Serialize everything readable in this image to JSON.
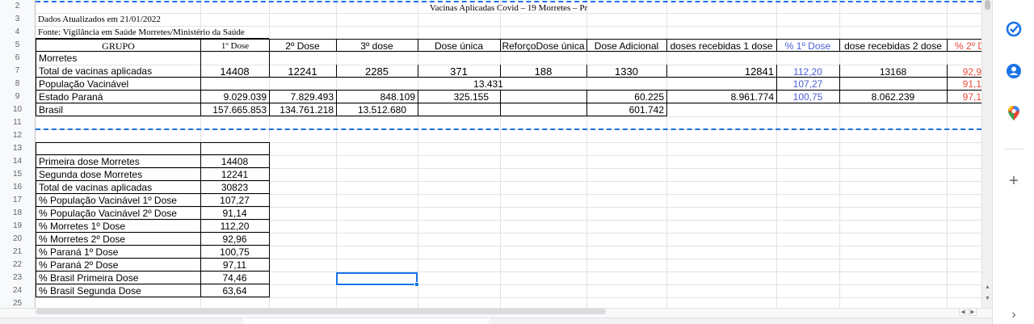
{
  "app": {
    "name": "Google Sheets"
  },
  "row_numbers": [
    "2",
    "3",
    "4",
    "5",
    "6",
    "7",
    "8",
    "9",
    "10",
    "11",
    "12",
    "13",
    "14",
    "15",
    "16",
    "17",
    "18",
    "19",
    "20",
    "21",
    "22",
    "23",
    "24",
    "25"
  ],
  "sheet": {
    "title": "Vacinas Aplicadas Covid – 19 Morretes – Pr",
    "updated": "Dados Atualizados em 21/01/2022",
    "source": "Fonte: Vigilância em Saúde Morretes/Ministério da Saúde",
    "headers": [
      "GRUPO",
      "1º Dose",
      "2º Dose",
      "3º dose",
      "Dose única",
      "ReforçoDose única",
      "Dose Adicional",
      "doses recebidas 1 dose",
      "% 1º Dose",
      "dose recebidas 2 dose",
      "% 2º D"
    ],
    "label_morretes": "Morretes",
    "total": {
      "label": "Total de vacinas aplicadas",
      "d1": "14408",
      "d2": "12241",
      "d3": "2285",
      "unica": "371",
      "reforco": "188",
      "adicional": "1330",
      "rec1": "12841",
      "pct1": "112,20",
      "rec2": "13168",
      "pct2": "92,9"
    },
    "populacao": {
      "label": "População Vacinável",
      "value": "13.431",
      "pct1": "107,27",
      "pct2": "91,1"
    },
    "parana": {
      "label": "Estado Paraná",
      "d1": "9.029.039",
      "d2": "7.829.493",
      "d3": "848.109",
      "unica": "325.155",
      "adicional": "60.225",
      "rec1": "8.961.774",
      "pct1": "100,75",
      "rec2": "8.062.239",
      "pct2": "97,1"
    },
    "brasil": {
      "label": "Brasil",
      "d1": "157.665.853",
      "d2": "134.761.218",
      "d3": "13.512.680",
      "adicional": "601.742"
    },
    "summary": [
      {
        "label": "Primeira dose Morretes",
        "value": "14408"
      },
      {
        "label": "Segunda dose Morretes",
        "value": "12241"
      },
      {
        "label": "Total de vacinas aplicadas",
        "value": "30823"
      },
      {
        "label": "% População Vacinável 1º Dose",
        "value": "107,27"
      },
      {
        "label": "% População Vacinável 2º Dose",
        "value": "91,14"
      },
      {
        "label": "% Morretes 1º Dose",
        "value": "112,20"
      },
      {
        "label": "% Morretes 2º Dose",
        "value": "92,96"
      },
      {
        "label": "% Paraná 1º Dose",
        "value": "100,75"
      },
      {
        "label": "% Paraná 2º Dose",
        "value": "97,11"
      },
      {
        "label": "% Brasil Primeira Dose",
        "value": "74,46"
      },
      {
        "label": "% Brasil Segunda Dose",
        "value": "63,64"
      }
    ]
  },
  "side_panel": {
    "icons": [
      "tasks-icon",
      "contacts-icon",
      "maps-icon",
      "add-addon-icon",
      "expand-panel-icon"
    ],
    "add_symbol": "+",
    "expand_symbol": "›",
    "colors": {
      "tasks": "#1a73e8",
      "contacts": "#1a73e8",
      "maps_red": "#ea4335",
      "maps_green": "#34a853"
    }
  },
  "colors": {
    "selection": "#1a73e8",
    "pct_blue": "#4a5fd6",
    "pct_red": "#e74c3c",
    "page_break": "#1a73e8"
  }
}
